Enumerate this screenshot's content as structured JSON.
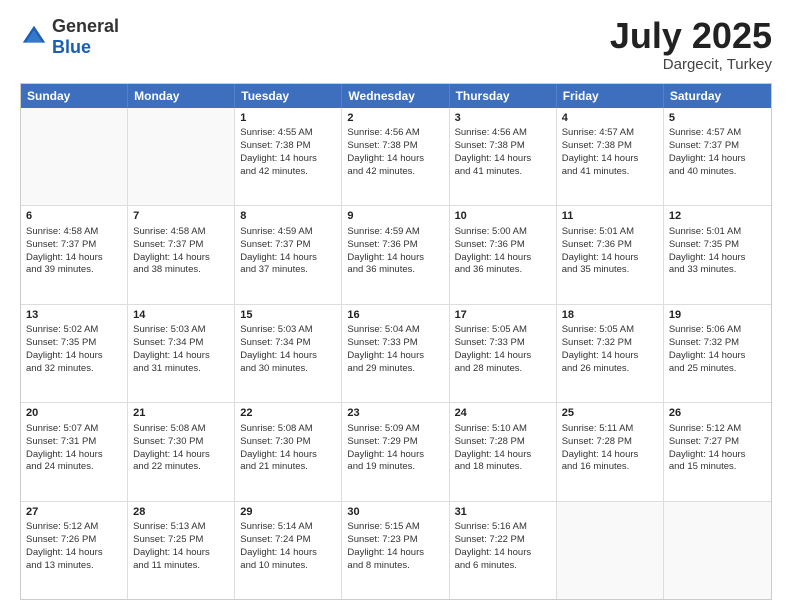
{
  "header": {
    "logo_general": "General",
    "logo_blue": "Blue",
    "title": "July 2025",
    "location": "Dargecit, Turkey"
  },
  "days_of_week": [
    "Sunday",
    "Monday",
    "Tuesday",
    "Wednesday",
    "Thursday",
    "Friday",
    "Saturday"
  ],
  "weeks": [
    [
      {
        "day": "",
        "lines": []
      },
      {
        "day": "",
        "lines": []
      },
      {
        "day": "1",
        "lines": [
          "Sunrise: 4:55 AM",
          "Sunset: 7:38 PM",
          "Daylight: 14 hours",
          "and 42 minutes."
        ]
      },
      {
        "day": "2",
        "lines": [
          "Sunrise: 4:56 AM",
          "Sunset: 7:38 PM",
          "Daylight: 14 hours",
          "and 42 minutes."
        ]
      },
      {
        "day": "3",
        "lines": [
          "Sunrise: 4:56 AM",
          "Sunset: 7:38 PM",
          "Daylight: 14 hours",
          "and 41 minutes."
        ]
      },
      {
        "day": "4",
        "lines": [
          "Sunrise: 4:57 AM",
          "Sunset: 7:38 PM",
          "Daylight: 14 hours",
          "and 41 minutes."
        ]
      },
      {
        "day": "5",
        "lines": [
          "Sunrise: 4:57 AM",
          "Sunset: 7:37 PM",
          "Daylight: 14 hours",
          "and 40 minutes."
        ]
      }
    ],
    [
      {
        "day": "6",
        "lines": [
          "Sunrise: 4:58 AM",
          "Sunset: 7:37 PM",
          "Daylight: 14 hours",
          "and 39 minutes."
        ]
      },
      {
        "day": "7",
        "lines": [
          "Sunrise: 4:58 AM",
          "Sunset: 7:37 PM",
          "Daylight: 14 hours",
          "and 38 minutes."
        ]
      },
      {
        "day": "8",
        "lines": [
          "Sunrise: 4:59 AM",
          "Sunset: 7:37 PM",
          "Daylight: 14 hours",
          "and 37 minutes."
        ]
      },
      {
        "day": "9",
        "lines": [
          "Sunrise: 4:59 AM",
          "Sunset: 7:36 PM",
          "Daylight: 14 hours",
          "and 36 minutes."
        ]
      },
      {
        "day": "10",
        "lines": [
          "Sunrise: 5:00 AM",
          "Sunset: 7:36 PM",
          "Daylight: 14 hours",
          "and 36 minutes."
        ]
      },
      {
        "day": "11",
        "lines": [
          "Sunrise: 5:01 AM",
          "Sunset: 7:36 PM",
          "Daylight: 14 hours",
          "and 35 minutes."
        ]
      },
      {
        "day": "12",
        "lines": [
          "Sunrise: 5:01 AM",
          "Sunset: 7:35 PM",
          "Daylight: 14 hours",
          "and 33 minutes."
        ]
      }
    ],
    [
      {
        "day": "13",
        "lines": [
          "Sunrise: 5:02 AM",
          "Sunset: 7:35 PM",
          "Daylight: 14 hours",
          "and 32 minutes."
        ]
      },
      {
        "day": "14",
        "lines": [
          "Sunrise: 5:03 AM",
          "Sunset: 7:34 PM",
          "Daylight: 14 hours",
          "and 31 minutes."
        ]
      },
      {
        "day": "15",
        "lines": [
          "Sunrise: 5:03 AM",
          "Sunset: 7:34 PM",
          "Daylight: 14 hours",
          "and 30 minutes."
        ]
      },
      {
        "day": "16",
        "lines": [
          "Sunrise: 5:04 AM",
          "Sunset: 7:33 PM",
          "Daylight: 14 hours",
          "and 29 minutes."
        ]
      },
      {
        "day": "17",
        "lines": [
          "Sunrise: 5:05 AM",
          "Sunset: 7:33 PM",
          "Daylight: 14 hours",
          "and 28 minutes."
        ]
      },
      {
        "day": "18",
        "lines": [
          "Sunrise: 5:05 AM",
          "Sunset: 7:32 PM",
          "Daylight: 14 hours",
          "and 26 minutes."
        ]
      },
      {
        "day": "19",
        "lines": [
          "Sunrise: 5:06 AM",
          "Sunset: 7:32 PM",
          "Daylight: 14 hours",
          "and 25 minutes."
        ]
      }
    ],
    [
      {
        "day": "20",
        "lines": [
          "Sunrise: 5:07 AM",
          "Sunset: 7:31 PM",
          "Daylight: 14 hours",
          "and 24 minutes."
        ]
      },
      {
        "day": "21",
        "lines": [
          "Sunrise: 5:08 AM",
          "Sunset: 7:30 PM",
          "Daylight: 14 hours",
          "and 22 minutes."
        ]
      },
      {
        "day": "22",
        "lines": [
          "Sunrise: 5:08 AM",
          "Sunset: 7:30 PM",
          "Daylight: 14 hours",
          "and 21 minutes."
        ]
      },
      {
        "day": "23",
        "lines": [
          "Sunrise: 5:09 AM",
          "Sunset: 7:29 PM",
          "Daylight: 14 hours",
          "and 19 minutes."
        ]
      },
      {
        "day": "24",
        "lines": [
          "Sunrise: 5:10 AM",
          "Sunset: 7:28 PM",
          "Daylight: 14 hours",
          "and 18 minutes."
        ]
      },
      {
        "day": "25",
        "lines": [
          "Sunrise: 5:11 AM",
          "Sunset: 7:28 PM",
          "Daylight: 14 hours",
          "and 16 minutes."
        ]
      },
      {
        "day": "26",
        "lines": [
          "Sunrise: 5:12 AM",
          "Sunset: 7:27 PM",
          "Daylight: 14 hours",
          "and 15 minutes."
        ]
      }
    ],
    [
      {
        "day": "27",
        "lines": [
          "Sunrise: 5:12 AM",
          "Sunset: 7:26 PM",
          "Daylight: 14 hours",
          "and 13 minutes."
        ]
      },
      {
        "day": "28",
        "lines": [
          "Sunrise: 5:13 AM",
          "Sunset: 7:25 PM",
          "Daylight: 14 hours",
          "and 11 minutes."
        ]
      },
      {
        "day": "29",
        "lines": [
          "Sunrise: 5:14 AM",
          "Sunset: 7:24 PM",
          "Daylight: 14 hours",
          "and 10 minutes."
        ]
      },
      {
        "day": "30",
        "lines": [
          "Sunrise: 5:15 AM",
          "Sunset: 7:23 PM",
          "Daylight: 14 hours",
          "and 8 minutes."
        ]
      },
      {
        "day": "31",
        "lines": [
          "Sunrise: 5:16 AM",
          "Sunset: 7:22 PM",
          "Daylight: 14 hours",
          "and 6 minutes."
        ]
      },
      {
        "day": "",
        "lines": []
      },
      {
        "day": "",
        "lines": []
      }
    ]
  ]
}
